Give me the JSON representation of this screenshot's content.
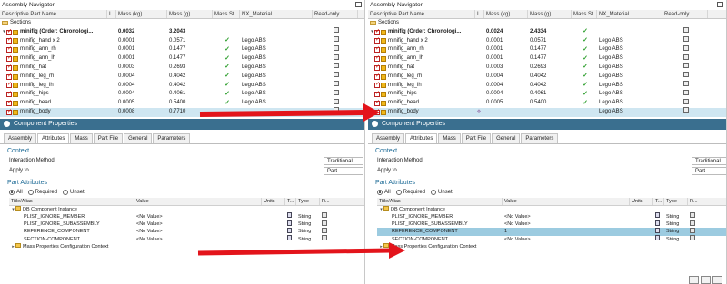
{
  "left": {
    "title": "Assembly Navigator",
    "columns": [
      "Descriptive Part Name",
      "I...",
      "Mass (kg)",
      "Mass (g)",
      "Mass St...",
      "NX_Material",
      "Read-only"
    ],
    "sections_label": "Sections",
    "rows": [
      {
        "name": "minifig (Order: Chronologi...",
        "mass_kg": "0.0032",
        "mass_g": "3.2043",
        "check": false,
        "material": "",
        "bold": true
      },
      {
        "name": "minifig_hand x 2",
        "mass_kg": "0.0001",
        "mass_g": "0.0571",
        "check": true,
        "material": "Lego ABS"
      },
      {
        "name": "minifig_arm_rh",
        "mass_kg": "0.0001",
        "mass_g": "0.1477",
        "check": true,
        "material": "Lego ABS"
      },
      {
        "name": "minifig_arm_lh",
        "mass_kg": "0.0001",
        "mass_g": "0.1477",
        "check": true,
        "material": "Lego ABS"
      },
      {
        "name": "minifig_hat",
        "mass_kg": "0.0003",
        "mass_g": "0.2693",
        "check": true,
        "material": "Lego ABS"
      },
      {
        "name": "minifig_leg_rh",
        "mass_kg": "0.0004",
        "mass_g": "0.4042",
        "check": true,
        "material": "Lego ABS"
      },
      {
        "name": "minifig_leg_lh",
        "mass_kg": "0.0004",
        "mass_g": "0.4042",
        "check": true,
        "material": "Lego ABS"
      },
      {
        "name": "minifig_hips",
        "mass_kg": "0.0004",
        "mass_g": "0.4061",
        "check": true,
        "material": "Lego ABS"
      },
      {
        "name": "minifig_head",
        "mass_kg": "0.0005",
        "mass_g": "0.5400",
        "check": true,
        "material": "Lego ABS"
      },
      {
        "name": "minifig_body",
        "mass_kg": "0.0008",
        "mass_g": "0.7710",
        "check": false,
        "material": "",
        "selected": true
      }
    ],
    "cp_title": "Component Properties",
    "tabs": [
      "Assembly",
      "Attributes",
      "Mass",
      "Part File",
      "General",
      "Parameters"
    ],
    "context_label": "Context",
    "interaction_label": "Interaction Method",
    "interaction_value": "Traditional",
    "apply_label": "Apply to",
    "apply_value": "Part",
    "pa_label": "Part Attributes",
    "radio_all": "All",
    "radio_required": "Required",
    "radio_unset": "Unset",
    "pa_columns": [
      "Title/Alias",
      "Value",
      "Units",
      "T...",
      "Type",
      "R..."
    ],
    "pa_group": "DB Component Instance",
    "pa_rows": [
      {
        "title": "PLIST_IGNORE_MEMBER",
        "value": "<No Value>",
        "type": "String"
      },
      {
        "title": "PLIST_IGNORE_SUBASSEMBLY",
        "value": "<No Value>",
        "type": "String"
      },
      {
        "title": "REFERENCE_COMPONENT",
        "value": "<No Value>",
        "type": "String"
      },
      {
        "title": "SECTION-COMPONENT",
        "value": "<No Value>",
        "type": "String"
      }
    ],
    "pa_group2": "Mass Properties Configuration Context"
  },
  "right": {
    "title": "Assembly Navigator",
    "columns": [
      "Descriptive Part Name",
      "I...",
      "Mass (kg)",
      "Mass (g)",
      "Mass St...",
      "NX_Material",
      "Read-only"
    ],
    "sections_label": "Sections",
    "rows": [
      {
        "name": "minifig (Order: Chronologi...",
        "mass_kg": "0.0024",
        "mass_g": "2.4334",
        "check": true,
        "material": "",
        "bold": true
      },
      {
        "name": "minifig_hand x 2",
        "mass_kg": "0.0001",
        "mass_g": "0.0571",
        "check": true,
        "material": "Lego ABS"
      },
      {
        "name": "minifig_arm_rh",
        "mass_kg": "0.0001",
        "mass_g": "0.1477",
        "check": true,
        "material": "Lego ABS"
      },
      {
        "name": "minifig_arm_lh",
        "mass_kg": "0.0001",
        "mass_g": "0.1477",
        "check": true,
        "material": "Lego ABS"
      },
      {
        "name": "minifig_hat",
        "mass_kg": "0.0003",
        "mass_g": "0.2693",
        "check": true,
        "material": "Lego ABS"
      },
      {
        "name": "minifig_leg_rh",
        "mass_kg": "0.0004",
        "mass_g": "0.4042",
        "check": true,
        "material": "Lego ABS"
      },
      {
        "name": "minifig_leg_lh",
        "mass_kg": "0.0004",
        "mass_g": "0.4042",
        "check": true,
        "material": "Lego ABS"
      },
      {
        "name": "minifig_hips",
        "mass_kg": "0.0004",
        "mass_g": "0.4061",
        "check": true,
        "material": "Lego ABS"
      },
      {
        "name": "minifig_head",
        "mass_kg": "0.0005",
        "mass_g": "0.5400",
        "check": true,
        "material": "Lego ABS"
      },
      {
        "name": "minifig_body",
        "mass_kg": "",
        "mass_g": "",
        "check": false,
        "material": "Lego ABS",
        "selected": true,
        "warn": true
      }
    ],
    "cp_title": "Component Properties",
    "tabs": [
      "Assembly",
      "Attributes",
      "Mass",
      "Part File",
      "General",
      "Parameters"
    ],
    "context_label": "Context",
    "interaction_label": "Interaction Method",
    "interaction_value": "Traditional",
    "apply_label": "Apply to",
    "apply_value": "Part",
    "pa_label": "Part Attributes",
    "radio_all": "All",
    "radio_required": "Required",
    "radio_unset": "Unset",
    "pa_columns": [
      "Title/Alias",
      "Value",
      "Units",
      "T...",
      "Type",
      "R..."
    ],
    "pa_group": "DB Component Instance",
    "pa_rows": [
      {
        "title": "PLIST_IGNORE_MEMBER",
        "value": "<No Value>",
        "type": "String"
      },
      {
        "title": "PLIST_IGNORE_SUBASSEMBLY",
        "value": "<No Value>",
        "type": "String"
      },
      {
        "title": "REFERENCE_COMPONENT",
        "value": "1",
        "type": "String",
        "selected": true
      },
      {
        "title": "SECTION-COMPONENT",
        "value": "<No Value>",
        "type": "String"
      }
    ],
    "pa_group2": "Mass Properties Configuration Context"
  },
  "colors": {
    "arrow": "#e3141b",
    "header_bar": "#3a6f8f",
    "section_text": "#1f6c97",
    "selected_row": "#cfe6f1",
    "selected_attr": "#9ccbe0"
  }
}
